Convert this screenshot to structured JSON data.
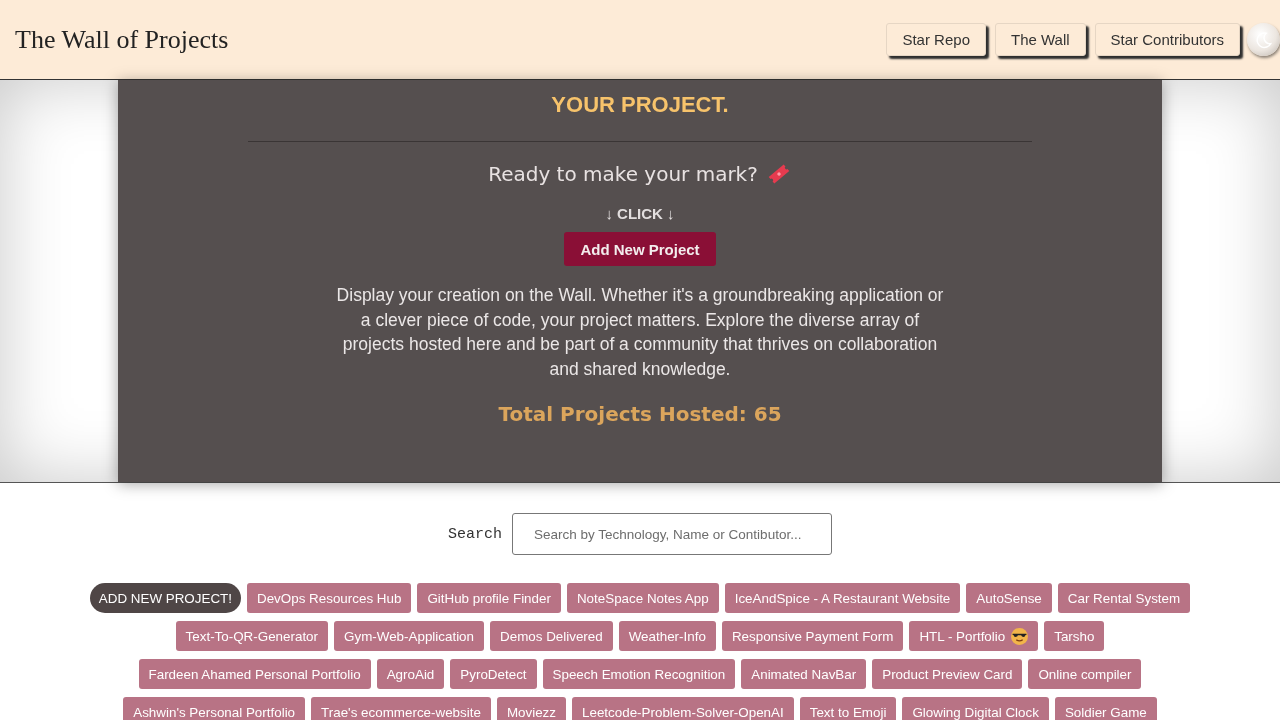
{
  "header": {
    "title": "The Wall of Projects",
    "nav": [
      {
        "label": "Star Repo"
      },
      {
        "label": "The Wall"
      },
      {
        "label": "Star Contributors"
      }
    ]
  },
  "hero": {
    "heading": "YOUR PROJECT.",
    "prompt": "Ready to make your mark?",
    "click_hint": "↓ CLICK ↓",
    "cta": "Add New Project",
    "description": "Display your creation on the Wall. Whether it's a groundbreaking application or a clever piece of code, your project matters. Explore the diverse array of projects hosted here and be part of a community that thrives on collaboration and shared knowledge.",
    "total": "Total Projects Hosted: 65"
  },
  "search": {
    "label": "Search",
    "placeholder": "Search by Technology, Name or Contibutor..."
  },
  "projects": [
    {
      "label": "ADD NEW PROJECT!",
      "kind": "add"
    },
    {
      "label": "DevOps Resources Hub",
      "kind": "project"
    },
    {
      "label": "GitHub profile Finder",
      "kind": "project"
    },
    {
      "label": "NoteSpace Notes App",
      "kind": "project"
    },
    {
      "label": "IceAndSpice - A Restaurant Website",
      "kind": "project"
    },
    {
      "label": "AutoSense",
      "kind": "project"
    },
    {
      "label": "Car Rental System",
      "kind": "project"
    },
    {
      "label": "Text-To-QR-Generator",
      "kind": "project"
    },
    {
      "label": "Gym-Web-Application",
      "kind": "project"
    },
    {
      "label": "Demos Delivered",
      "kind": "project"
    },
    {
      "label": "Weather-Info",
      "kind": "project"
    },
    {
      "label": "Responsive Payment Form",
      "kind": "project"
    },
    {
      "label": "HTL - Portfolio",
      "kind": "project-emoji"
    },
    {
      "label": "Tarsho",
      "kind": "project"
    },
    {
      "label": "Fardeen Ahamed Personal Portfolio",
      "kind": "project"
    },
    {
      "label": "AgroAid",
      "kind": "project"
    },
    {
      "label": "PyroDetect",
      "kind": "project"
    },
    {
      "label": "Speech Emotion Recognition",
      "kind": "project"
    },
    {
      "label": "Animated NavBar",
      "kind": "project"
    },
    {
      "label": "Product Preview Card",
      "kind": "project"
    },
    {
      "label": "Online compiler",
      "kind": "project"
    },
    {
      "label": "Ashwin's Personal Portfolio",
      "kind": "project"
    },
    {
      "label": "Trae's ecommerce-website",
      "kind": "project"
    },
    {
      "label": "Moviezz",
      "kind": "project"
    },
    {
      "label": "Leetcode-Problem-Solver-OpenAI",
      "kind": "project"
    },
    {
      "label": "Text to Emoji",
      "kind": "project"
    },
    {
      "label": "Glowing Digital Clock",
      "kind": "project"
    },
    {
      "label": "Soldier Game",
      "kind": "project"
    }
  ]
}
